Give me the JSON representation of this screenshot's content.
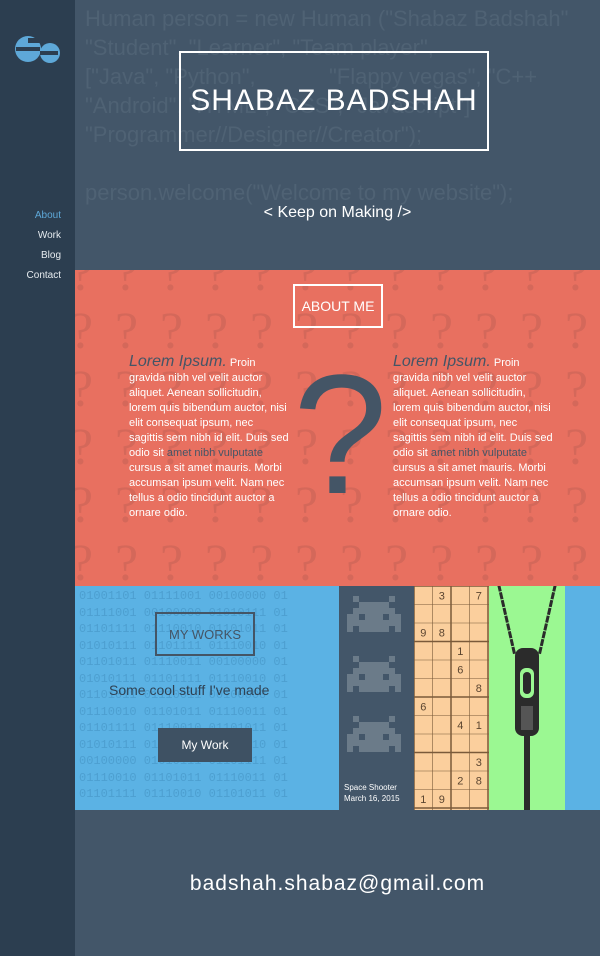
{
  "sidebar": {
    "logo_alt": "Sb",
    "nav": [
      {
        "label": "About",
        "active": true
      },
      {
        "label": "Work",
        "active": false
      },
      {
        "label": "Blog",
        "active": false
      },
      {
        "label": "Contact",
        "active": false
      }
    ]
  },
  "hero": {
    "background_code": "Human person = new Human (\"Shabaz Badshah\"\n\"Student\", \"Learner\", \"Team player\",\n[\"Java\", \"Python\",            \"Flappy vegas\", \"C++\n\"Android\", \"HTML\", \"CSS\", \"Javascript\"]\n\"Programmer//Designer//Creator\");\n\nperson.welcome(\"Welcome to my website\");",
    "title": "SHABAZ BADSHAH",
    "tagline": "< Keep on Making />"
  },
  "about": {
    "heading": "ABOUT ME",
    "big_glyph": "?",
    "columns": [
      {
        "lead": "Lorem Ipsum.",
        "text1": " Proin gravida nibh vel velit auctor aliquet. Aenean sollicitudin, lorem quis bibendum auctor, nisi elit consequat ipsum, nec sagittis sem nibh id elit. Duis sed odio sit ",
        "highlight": "amet nibh vulputate",
        "text2": " cursus a sit amet mauris. Morbi accumsan ipsum velit. Nam nec tellus a odio tincidunt auctor a ornare odio."
      },
      {
        "lead": "Lorem Ipsum.",
        "text1": " Proin gravida nibh vel velit auctor aliquet. Aenean sollicitudin, lorem quis bibendum auctor, nisi elit consequat ipsum, nec sagittis sem nibh id elit. Duis sed odio sit ",
        "highlight": "amet nibh vulputate",
        "text2": " cursus a sit amet mauris. Morbi accumsan ipsum velit. Nam nec tellus a odio tincidunt auctor a ornare odio."
      }
    ]
  },
  "works": {
    "background_binary": "01001101 01111001 00100000 01\n01111001 00100000 01010111 01\n01101111 01110010 01101011 01\n01010111 01101111 01110010 01\n01101011 01110011 00100000 01\n01010111 01101111 01110010 01\n01101011 01110011 00100000 01\n01110010 01101011 01110011 01\n01101111 01110010 01101011 01\n01010111 01101111 01110010 01\n00100000 01010111 01101111 01\n01110010 01101011 01110011 01\n01101111 01110010 01101011 01",
    "heading": "MY WORKS",
    "subtitle": "Some cool stuff I've made",
    "button": "My Work",
    "tiles": [
      {
        "name": "Space Shooter",
        "date": "March 16, 2015",
        "icon": "space-invader-icon"
      },
      {
        "icon": "sudoku-grid-icon",
        "digits": [
          "3",
          "7",
          "9",
          "8",
          "1",
          "6",
          "8",
          "6",
          "4",
          "1",
          "3",
          "2",
          "8",
          "1",
          "9"
        ]
      },
      {
        "icon": "zipper-icon"
      }
    ]
  },
  "footer": {
    "email": "badshah.shabaz@gmail.com"
  },
  "colors": {
    "sidebar": "#2c3e50",
    "hero": "#435669",
    "about": "#e87060",
    "works": "#5bb2e4",
    "accent": "#5ea8d8",
    "sudoku": "#fbcf9d",
    "zipper": "#9bf892"
  }
}
